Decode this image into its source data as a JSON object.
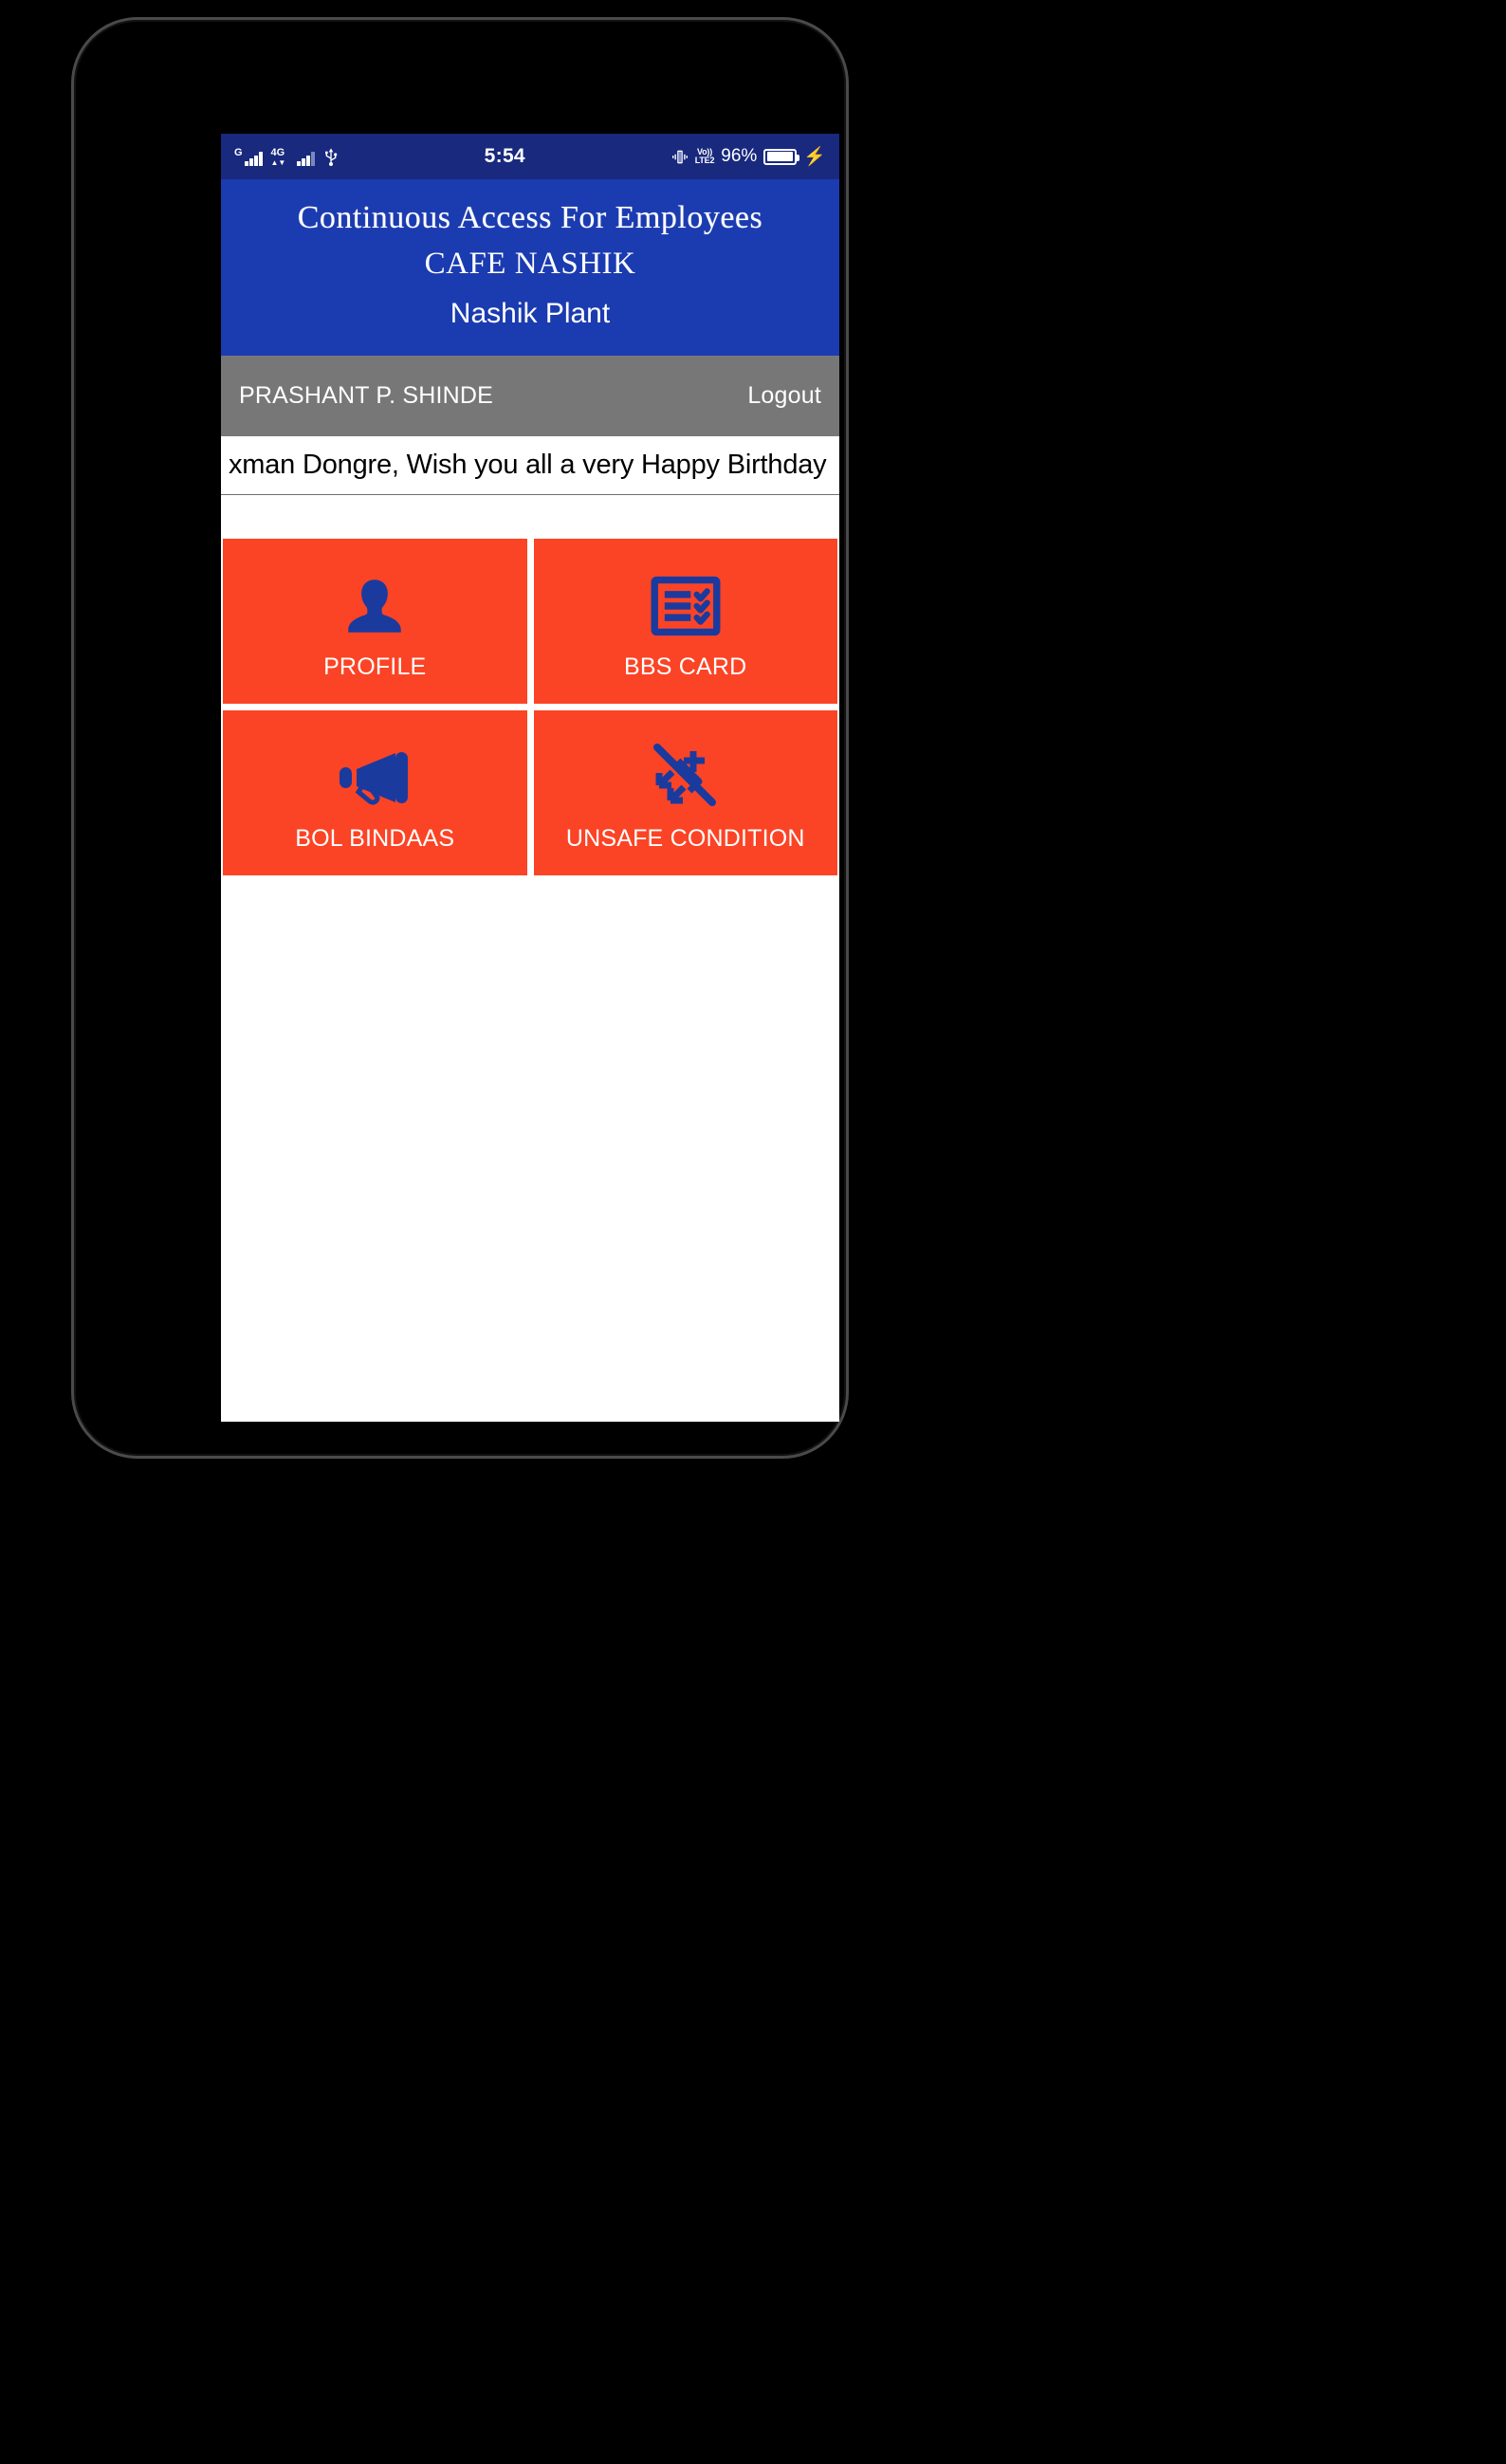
{
  "status_bar": {
    "network_1_label": "G",
    "network_2_label": "4G",
    "usb_icon": "usb-icon",
    "time": "5:54",
    "vibrate_icon": "vibrate-icon",
    "volte_line1": "Vo))",
    "volte_line2": "LTE2",
    "battery_percent": "96%",
    "charging_icon": "charging-bolt-icon",
    "bg_color": "#19297e"
  },
  "header": {
    "title": "Continuous Access For Employees",
    "subtitle": "CAFE NASHIK",
    "plant": "Nashik Plant",
    "bg_color": "#1b3bb0"
  },
  "user_bar": {
    "user_name": "PRASHANT P. SHINDE",
    "logout_label": "Logout",
    "bg_color": "#777777"
  },
  "marquee": {
    "text": "xman Dongre, Wish you all a very Happy Birthday"
  },
  "tiles": [
    {
      "label": "PROFILE",
      "icon": "person-icon"
    },
    {
      "label": "BBS CARD",
      "icon": "checklist-icon"
    },
    {
      "label": "BOL BINDAAS",
      "icon": "megaphone-icon"
    },
    {
      "label": "UNSAFE CONDITION",
      "icon": "unsafe-condition-icon"
    }
  ],
  "theme": {
    "tile_bg": "#fb4425",
    "tile_icon_color": "#1b3a9e",
    "tile_text": "#ffffff"
  }
}
